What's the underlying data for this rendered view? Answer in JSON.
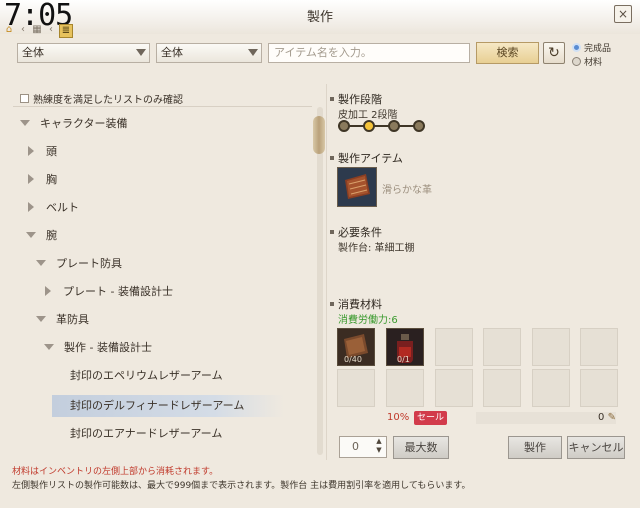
{
  "clock": "7:05",
  "window": {
    "title": "製作",
    "close": "×"
  },
  "nav": {
    "home_icon": "⌂",
    "grid_icon": "▦",
    "list_icon": "≣"
  },
  "toolbar": {
    "filter1": "全体",
    "filter2": "全体",
    "search_placeholder": "アイテム名を入力。",
    "search_button": "検索",
    "refresh_icon": "↻",
    "radio_finished": "完成品",
    "radio_material": "材料"
  },
  "left": {
    "checkbox_label": "熟練度を満足したリストのみ確認",
    "tree": [
      {
        "label": "キャラクター装備"
      },
      {
        "label": "頭"
      },
      {
        "label": "胸"
      },
      {
        "label": "ベルト"
      },
      {
        "label": "腕"
      },
      {
        "label": "プレート防具"
      },
      {
        "label": "プレート - 装備設計士"
      },
      {
        "label": "革防具"
      },
      {
        "label": "製作 - 装備設計士"
      },
      {
        "label": "封印のエペリウムレザーアーム"
      },
      {
        "label": "封印のデルフィナードレザーアーム"
      },
      {
        "label": "封印のエアナードレザーアーム"
      }
    ]
  },
  "right": {
    "stage_heading": "製作段階",
    "stage_text": "皮加工 2段階",
    "stages": [
      {
        "active": false
      },
      {
        "active": true
      },
      {
        "active": false
      },
      {
        "active": false
      }
    ],
    "item_heading": "製作アイテム",
    "item_name": "滑らかな革",
    "req_heading": "必要条件",
    "req_text": "製作台: 革細工棚",
    "mat_heading": "消費材料",
    "labor": "消費労働力:6",
    "slot1_count": "0/40",
    "slot2_count": "0/1",
    "discount": "10%",
    "sale": "セール",
    "cost": "0",
    "qty": "0",
    "max_button": "最大数",
    "make_button": "製作",
    "cancel_button": "キャンセル"
  },
  "footer": {
    "warning": "材料はインベントリの左側上部から消耗されます。",
    "note": "左側製作リストの製作可能数は、最大で999個まで表示されます。製作台 主は費用割引率を適用してもらいます。"
  },
  "colors": {
    "accent": "#f5c43a",
    "warning": "#c0392b",
    "labor": "#3a9a2e",
    "sale": "#d23b4b"
  }
}
